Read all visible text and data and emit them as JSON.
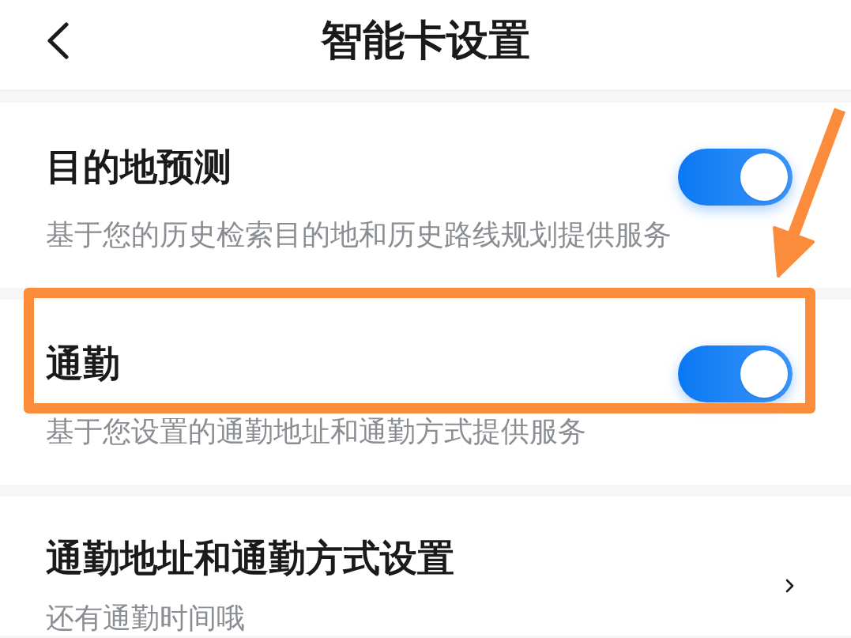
{
  "header": {
    "title": "智能卡设置"
  },
  "sections": [
    {
      "kind": "toggle",
      "title": "目的地预测",
      "description": "基于您的历史检索目的地和历史路线规划提供服务",
      "on": true,
      "highlighted": false
    },
    {
      "kind": "toggle",
      "title": "通勤",
      "description": "基于您设置的通勤地址和通勤方式提供服务",
      "on": true,
      "highlighted": true
    },
    {
      "kind": "link",
      "title": "通勤地址和通勤方式设置",
      "description": "还有通勤时间哦",
      "highlighted": false
    }
  ]
}
